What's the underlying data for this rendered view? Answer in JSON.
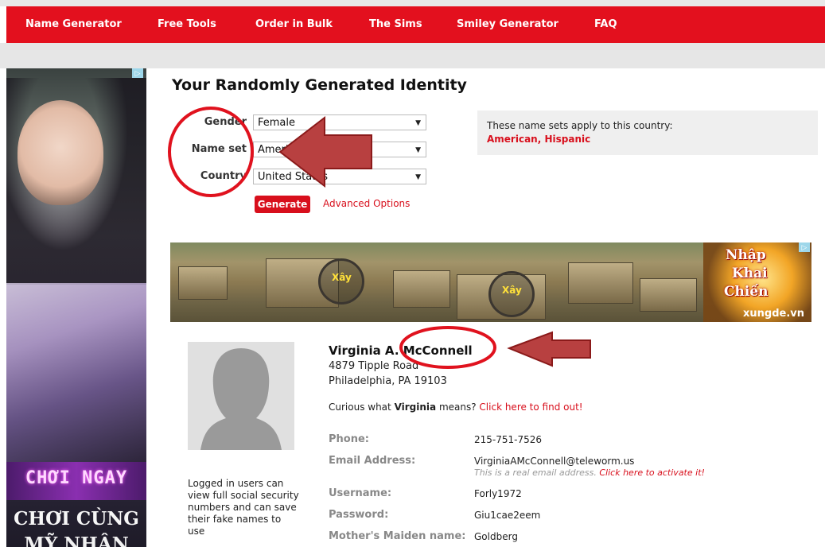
{
  "nav": {
    "items": [
      "Name Generator",
      "Free Tools",
      "Order in Bulk",
      "The Sims",
      "Smiley Generator",
      "FAQ"
    ],
    "active": "Name Generator",
    "accent": "#e3101e"
  },
  "left_ad": {
    "text1": "CHƠI NGAY",
    "text2": "CHƠI CÙNG",
    "text3": "MỸ NHÂN"
  },
  "page": {
    "title": "Your Randomly Generated Identity"
  },
  "form": {
    "gender_label": "Gender",
    "gender_value": "Female",
    "nameset_label": "Name set",
    "nameset_value": "American",
    "country_label": "Country",
    "country_value": "United States",
    "generate_label": "Generate",
    "advanced_label": "Advanced Options"
  },
  "info": {
    "text": "These name sets apply to this country:",
    "link": "American, Hispanic"
  },
  "banner": {
    "button_label": "Xây",
    "logo_lines": [
      "Nhập",
      "Khai",
      "Chiến"
    ],
    "site": "xungde.vn"
  },
  "identity": {
    "name": "Virginia A. McConnell",
    "address_line1": "4879 Tipple Road",
    "address_line2": "Philadelphia, PA 19103",
    "curious_prefix": "Curious what ",
    "curious_name": "Virginia",
    "curious_suffix": " means? ",
    "curious_link": "Click here to find out!",
    "logged_in_note": "Logged in users can view full social security numbers and can save their fake names to use",
    "fields": {
      "phone_label": "Phone:",
      "phone_value": "215-751-7526",
      "email_label": "Email Address:",
      "email_value": "VirginiaAMcConnell@teleworm.us",
      "email_note": "This is a real email address. ",
      "email_note_link": "Click here to activate it!",
      "username_label": "Username:",
      "username_value": "Forly1972",
      "password_label": "Password:",
      "password_value": "Giu1cae2eem",
      "maiden_label": "Mother's Maiden name:",
      "maiden_value": "Goldberg"
    }
  },
  "annotation_color": "#b81a1a"
}
